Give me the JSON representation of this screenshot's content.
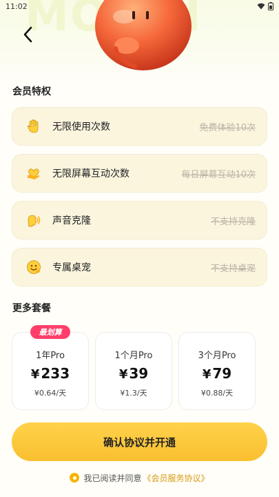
{
  "status_bar": {
    "time": "11:02"
  },
  "hero": {
    "bg_text": "MOUNI"
  },
  "perks_section": {
    "title": "会员特权"
  },
  "perks": [
    {
      "icon": "wave-hand-icon",
      "name": "无限使用次数",
      "note": "免费体验10次"
    },
    {
      "icon": "heart-hand-icon",
      "name": "无限屏幕互动次数",
      "note": "每日屏幕互动10次"
    },
    {
      "icon": "voice-icon",
      "name": "声音克隆",
      "note": "不支持克隆"
    },
    {
      "icon": "pet-icon",
      "name": "专属桌宠",
      "note": "不支持桌宠"
    }
  ],
  "plans_section": {
    "title": "更多套餐"
  },
  "plans": [
    {
      "name": "1年Pro",
      "currency": "¥",
      "price": "233",
      "daily": "¥0.64/天",
      "badge": "最划算"
    },
    {
      "name": "1个月Pro",
      "currency": "¥",
      "price": "39",
      "daily": "¥1.3/天"
    },
    {
      "name": "3个月Pro",
      "currency": "¥",
      "price": "79",
      "daily": "¥0.88/天"
    }
  ],
  "confirm": {
    "label": "确认协议并开通"
  },
  "agreement": {
    "text": "我已阅读并同意",
    "link": "《会员服务协议》"
  },
  "colors": {
    "accent": "#f9bf2f",
    "badge": "#ff3f6a",
    "perk_bg": "#fbf5de"
  }
}
